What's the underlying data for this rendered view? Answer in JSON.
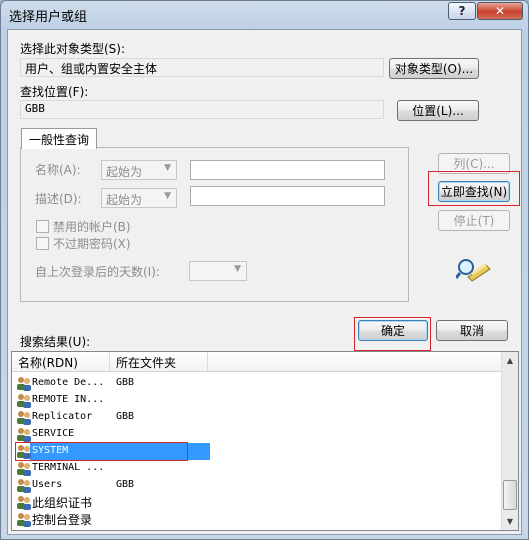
{
  "window": {
    "title": "选择用户或组",
    "help_glyph": "?",
    "close_glyph": "✕"
  },
  "object_type": {
    "label": "选择此对象类型(S):",
    "value": "用户、组或内置安全主体",
    "button": "对象类型(O)..."
  },
  "location": {
    "label": "查找位置(F):",
    "value": "GBB",
    "button": "位置(L)..."
  },
  "query": {
    "tab": "一般性查询",
    "name_label": "名称(A):",
    "name_mode": "起始为",
    "name_value": "",
    "desc_label": "描述(D):",
    "desc_mode": "起始为",
    "desc_value": "",
    "disabled_accounts": "禁用的帐户(B)",
    "non_expiring_pw": "不过期密码(X)",
    "days_label": "自上次登录后的天数(I):",
    "days_value": ""
  },
  "side_buttons": {
    "columns": "列(C)...",
    "find_now": "立即查找(N)",
    "stop": "停止(T)",
    "search_icon": "magnifier-icon"
  },
  "results": {
    "label": "搜索结果(U):",
    "ok": "确定",
    "cancel": "取消",
    "col_name": "名称(RDN)",
    "col_folder": "所在文件夹",
    "rows": [
      {
        "name": "Remote De...",
        "folder": "GBB"
      },
      {
        "name": "REMOTE IN...",
        "folder": ""
      },
      {
        "name": "Replicator",
        "folder": "GBB"
      },
      {
        "name": "SERVICE",
        "folder": ""
      },
      {
        "name": "SYSTEM",
        "folder": ""
      },
      {
        "name": "TERMINAL ...",
        "folder": ""
      },
      {
        "name": "Users",
        "folder": "GBB"
      },
      {
        "name": "此组织证书",
        "folder": ""
      },
      {
        "name": "控制台登录",
        "folder": ""
      }
    ],
    "selected_row": "SYSTEM"
  },
  "colors": {
    "highlight": "#d6262c",
    "selection": "#3399ff"
  }
}
